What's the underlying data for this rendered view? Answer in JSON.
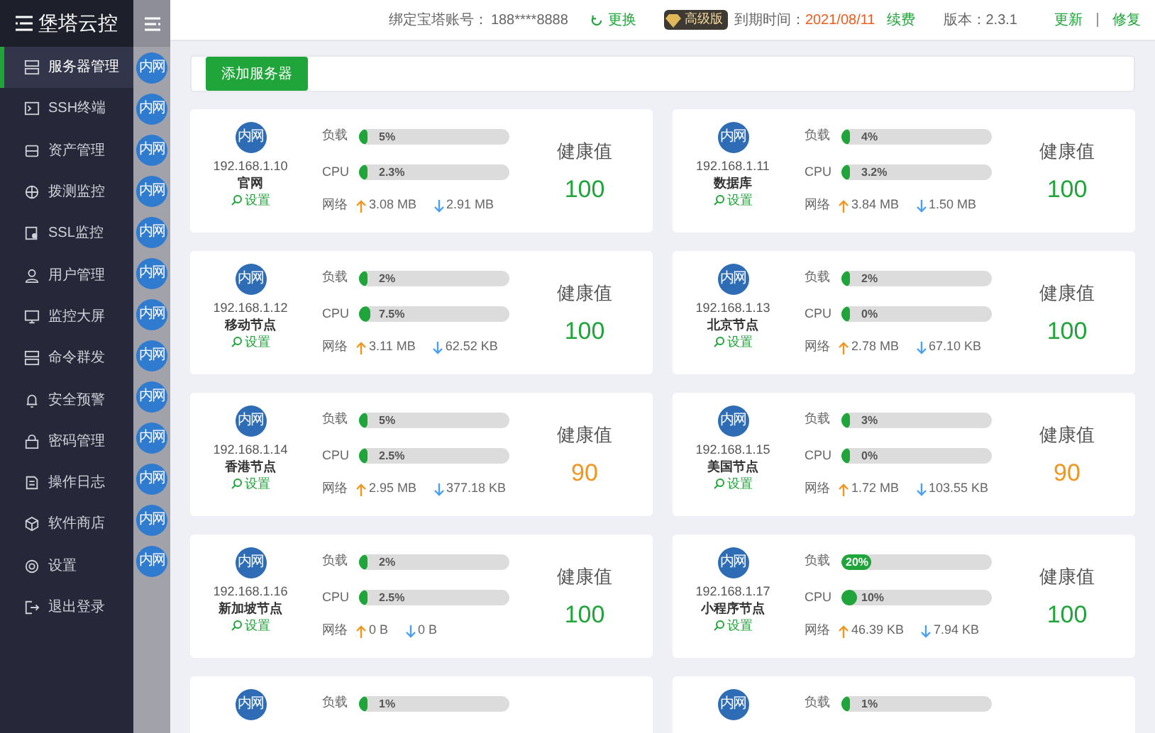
{
  "logo": {
    "text": "堡塔云控"
  },
  "sidebar": {
    "items": [
      {
        "label": "服务器管理",
        "selected": true
      },
      {
        "label": "SSH终端",
        "selected": false
      },
      {
        "label": "资产管理",
        "selected": false
      },
      {
        "label": "拨测监控",
        "selected": false
      },
      {
        "label": "SSL监控",
        "selected": false
      },
      {
        "label": "用户管理",
        "selected": false
      },
      {
        "label": "监控大屏",
        "selected": false
      },
      {
        "label": "命令群发",
        "selected": false
      },
      {
        "label": "安全预警",
        "selected": false
      },
      {
        "label": "密码管理",
        "selected": false
      },
      {
        "label": "操作日志",
        "selected": false
      },
      {
        "label": "软件商店",
        "selected": false
      },
      {
        "label": "设置",
        "selected": false
      },
      {
        "label": "退出登录",
        "selected": false
      }
    ]
  },
  "side_badges": [
    "内网",
    "内网",
    "内网",
    "内网",
    "内网",
    "内网",
    "内网",
    "内网",
    "内网",
    "内网",
    "内网",
    "内网",
    "内网"
  ],
  "topbar": {
    "account_label": "绑定宝塔账号：",
    "account": "188****8888",
    "change": "更换",
    "edition": "高级版",
    "expire_label": "到期时间：",
    "expire": "2021/08/11",
    "renew": "续费",
    "version": "版本：2.3.1",
    "update": "更新",
    "repair": "修复"
  },
  "add_button": "添加服务器",
  "servers": [
    {
      "badge": "内网",
      "ip": "192.168.1.10",
      "name": "官网",
      "settings": "设置",
      "load_label": "负载",
      "load": {
        "level": 0.05,
        "reading": "5%"
      },
      "cpu_label": "CPU",
      "cpu": {
        "level": 0.023,
        "reading": "2.3%"
      },
      "net_label": "网络",
      "up": "3.08 MB",
      "down": "2.91 MB",
      "health_label": "健康值",
      "health": "100",
      "kind": "good"
    },
    {
      "badge": "内网",
      "ip": "192.168.1.11",
      "name": "数据库",
      "settings": "设置",
      "load_label": "负载",
      "load": {
        "level": 0.04,
        "reading": "4%"
      },
      "cpu_label": "CPU",
      "cpu": {
        "level": 0.032,
        "reading": "3.2%"
      },
      "net_label": "网络",
      "up": "3.84 MB",
      "down": "1.50 MB",
      "health_label": "健康值",
      "health": "100",
      "kind": "good"
    },
    {
      "badge": "内网",
      "ip": "192.168.1.12",
      "name": "移动节点",
      "settings": "设置",
      "load_label": "负载",
      "load": {
        "level": 0.02,
        "reading": "2%"
      },
      "cpu_label": "CPU",
      "cpu": {
        "level": 0.075,
        "reading": "7.5%"
      },
      "net_label": "网络",
      "up": "3.11 MB",
      "down": "62.52 KB",
      "health_label": "健康值",
      "health": "100",
      "kind": "good"
    },
    {
      "badge": "内网",
      "ip": "192.168.1.13",
      "name": "北京节点",
      "settings": "设置",
      "load_label": "负载",
      "load": {
        "level": 0.02,
        "reading": "2%"
      },
      "cpu_label": "CPU",
      "cpu": {
        "level": 0,
        "reading": "0%"
      },
      "net_label": "网络",
      "up": "2.78 MB",
      "down": "67.10 KB",
      "health_label": "健康值",
      "health": "100",
      "kind": "good"
    },
    {
      "badge": "内网",
      "ip": "192.168.1.14",
      "name": "香港节点",
      "settings": "设置",
      "load_label": "负载",
      "load": {
        "level": 0.05,
        "reading": "5%"
      },
      "cpu_label": "CPU",
      "cpu": {
        "level": 0.025,
        "reading": "2.5%"
      },
      "net_label": "网络",
      "up": "2.95 MB",
      "down": "377.18 KB",
      "health_label": "健康值",
      "health": "90",
      "kind": "warn"
    },
    {
      "badge": "内网",
      "ip": "192.168.1.15",
      "name": "美国节点",
      "settings": "设置",
      "load_label": "负载",
      "load": {
        "level": 0.03,
        "reading": "3%"
      },
      "cpu_label": "CPU",
      "cpu": {
        "level": 0,
        "reading": "0%"
      },
      "net_label": "网络",
      "up": "1.72 MB",
      "down": "103.55 KB",
      "health_label": "健康值",
      "health": "90",
      "kind": "warn"
    },
    {
      "badge": "内网",
      "ip": "192.168.1.16",
      "name": "新加坡节点",
      "settings": "设置",
      "load_label": "负载",
      "load": {
        "level": 0.02,
        "reading": "2%"
      },
      "cpu_label": "CPU",
      "cpu": {
        "level": 0.025,
        "reading": "2.5%"
      },
      "net_label": "网络",
      "up": "0 B",
      "down": "0 B",
      "health_label": "健康值",
      "health": "100",
      "kind": "good"
    },
    {
      "badge": "内网",
      "ip": "192.168.1.17",
      "name": "小程序节点",
      "settings": "设置",
      "load_label": "负载",
      "load": {
        "level": 0.2,
        "reading": "20%"
      },
      "cpu_label": "CPU",
      "cpu": {
        "level": 0.1,
        "reading": "10%"
      },
      "net_label": "网络",
      "up": "46.39 KB",
      "down": "7.94 KB",
      "health_label": "健康值",
      "health": "100",
      "kind": "good"
    },
    {
      "badge": "内网",
      "load_label": "负载",
      "load": {
        "level": 0.01,
        "reading": "1%"
      }
    },
    {
      "badge": "内网",
      "load_label": "负载",
      "load": {
        "level": 0.01,
        "reading": "1%"
      }
    }
  ]
}
